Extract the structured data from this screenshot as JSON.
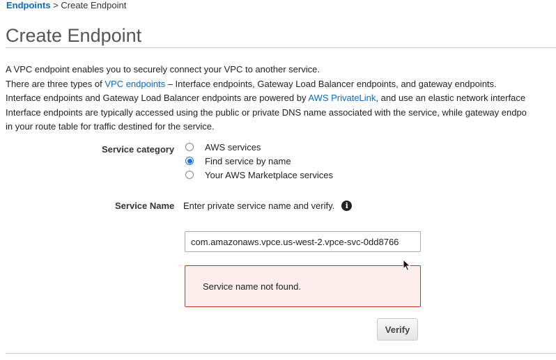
{
  "breadcrumb": {
    "link": "Endpoints",
    "separator": " > ",
    "current": "Create Endpoint"
  },
  "page_title": "Create Endpoint",
  "intro": {
    "line1": "A VPC endpoint enables you to securely connect your VPC to another service.",
    "line2_pre": "There are three types of ",
    "line2_link": "VPC endpoints",
    "line2_post": " – Interface endpoints, Gateway Load Balancer endpoints, and gateway endpoints.",
    "line3_pre": "Interface endpoints and Gateway Load Balancer endpoints are powered by ",
    "line3_link": "AWS PrivateLink",
    "line3_post": ", and use an elastic network interface",
    "line4": "Interface endpoints are typically accessed using the public or private DNS name associated with the service, while gateway endpo",
    "line5": "in your route table for traffic destined for the service."
  },
  "service_category": {
    "label": "Service category",
    "options": [
      {
        "label": "AWS services",
        "checked": false
      },
      {
        "label": "Find service by name",
        "checked": true
      },
      {
        "label": "Your AWS Marketplace services",
        "checked": false
      }
    ]
  },
  "service_name": {
    "label": "Service Name",
    "help": "Enter private service name and verify.",
    "info_icon": "i",
    "value": "com.amazonaws.vpce.us-west-2.vpce-svc-0dd8766"
  },
  "error": {
    "message": "Service name not found."
  },
  "verify_button": {
    "label": "Verify"
  },
  "colors": {
    "link": "#0a6bc2",
    "error_border": "#d13212",
    "error_bg": "#fbeeec",
    "radio_checked": "#1a73e8"
  }
}
